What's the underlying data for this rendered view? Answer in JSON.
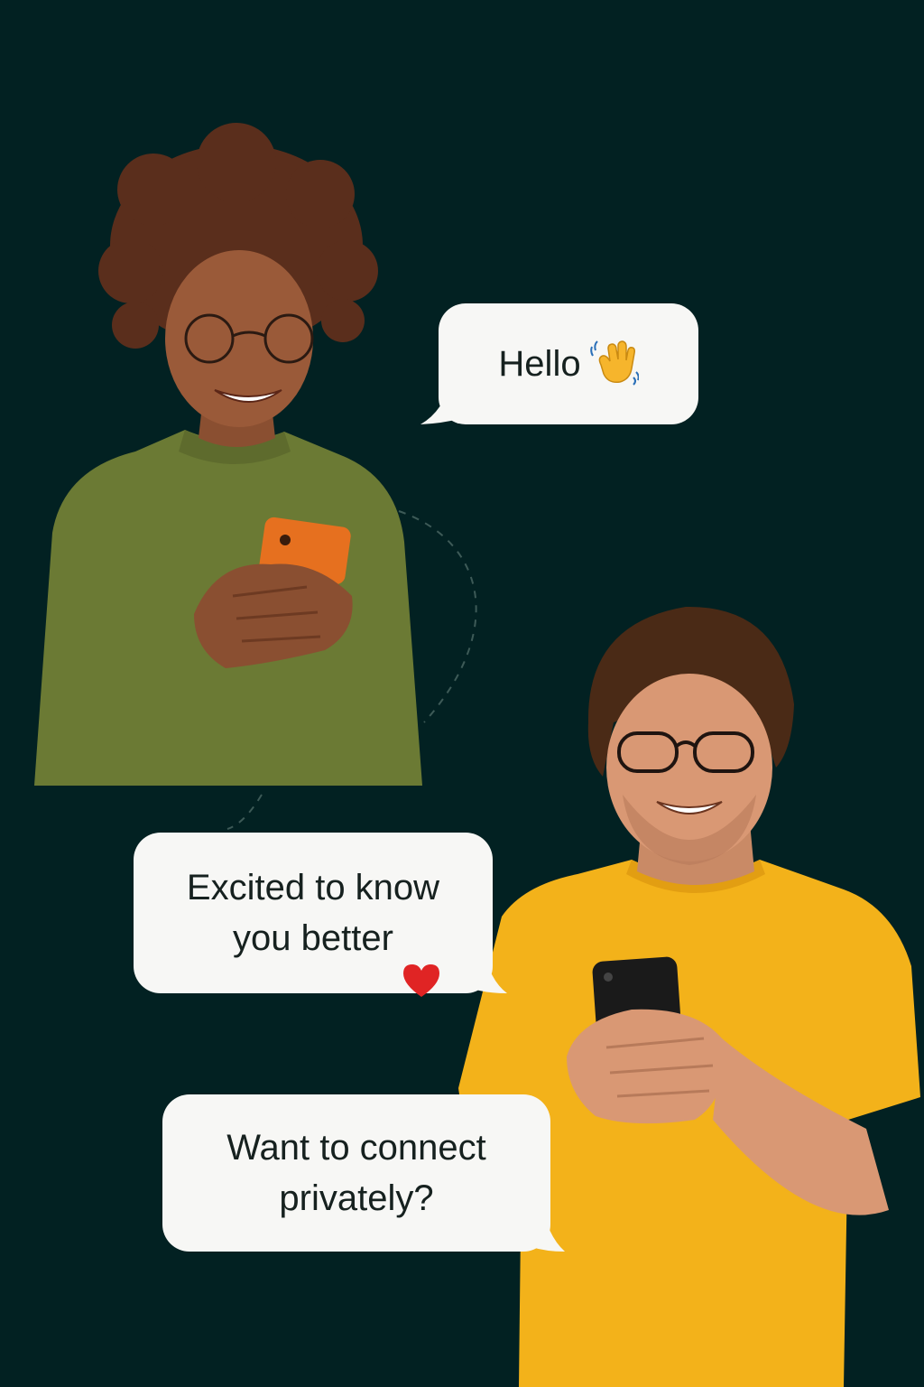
{
  "messages": [
    {
      "text": "Hello",
      "emoji": "waving-hand-icon",
      "sender": "woman"
    },
    {
      "text": "Excited to know\nyou better",
      "emoji": "red-heart-icon",
      "sender": "man"
    },
    {
      "text": "Want to connect\nprivately?",
      "sender": "man"
    }
  ],
  "colors": {
    "background": "#022122",
    "bubble": "#f7f7f5",
    "bubble_text": "#16211f",
    "woman_sweater": "#6b7a34",
    "woman_phone": "#e6701f",
    "man_tshirt": "#f3b21a",
    "man_phone": "#1a1a1a",
    "heart": "#e02424",
    "wave_hand": "#f6b52c"
  }
}
